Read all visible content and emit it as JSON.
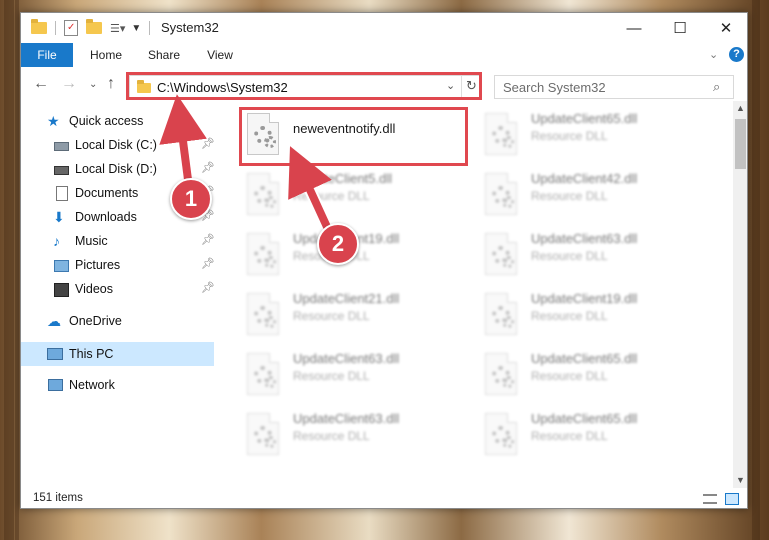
{
  "window": {
    "title": "System32",
    "controls": {
      "minimize": "—",
      "maximize": "☐",
      "close": "✕"
    }
  },
  "ribbon": {
    "tabs": [
      "File",
      "Home",
      "Share",
      "View"
    ],
    "help": "?"
  },
  "navigation": {
    "address": "C:\\Windows\\System32",
    "search_placeholder": "Search System32"
  },
  "sidebar": {
    "items": [
      {
        "label": "Quick access",
        "icon": "star-icon",
        "pinned": false
      },
      {
        "label": "Local Disk (C:)",
        "icon": "drive-icon",
        "pinned": true
      },
      {
        "label": "Local Disk (D:)",
        "icon": "drive-icon",
        "pinned": true
      },
      {
        "label": "Documents",
        "icon": "documents-icon",
        "pinned": true
      },
      {
        "label": "Downloads",
        "icon": "download-icon",
        "pinned": true
      },
      {
        "label": "Music",
        "icon": "music-icon",
        "pinned": true
      },
      {
        "label": "Pictures",
        "icon": "pictures-icon",
        "pinned": true
      },
      {
        "label": "Videos",
        "icon": "videos-icon",
        "pinned": true
      },
      {
        "label": "OneDrive",
        "icon": "cloud-icon",
        "pinned": false
      },
      {
        "label": "This PC",
        "icon": "computer-icon",
        "pinned": false,
        "selected": true
      },
      {
        "label": "Network",
        "icon": "network-icon",
        "pinned": false
      }
    ]
  },
  "files": {
    "column1": [
      {
        "name": "neweventnotify.dll",
        "type": ""
      },
      {
        "name": "UpdateClient5.dll",
        "type": "Resource DLL"
      },
      {
        "name": "UpdateClient19.dll",
        "type": "Resource DLL"
      },
      {
        "name": "UpdateClient21.dll",
        "type": "Resource DLL"
      },
      {
        "name": "UpdateClient63.dll",
        "type": "Resource DLL"
      },
      {
        "name": "UpdateClient63.dll",
        "type": "Resource DLL"
      }
    ],
    "column2": [
      {
        "name": "UpdateClient65.dll",
        "type": "Resource DLL"
      },
      {
        "name": "UpdateClient42.dll",
        "type": "Resource DLL"
      },
      {
        "name": "UpdateClient63.dll",
        "type": "Resource DLL"
      },
      {
        "name": "UpdateClient19.dll",
        "type": "Resource DLL"
      },
      {
        "name": "UpdateClient65.dll",
        "type": "Resource DLL"
      },
      {
        "name": "UpdateClient65.dll",
        "type": "Resource DLL"
      }
    ]
  },
  "status": {
    "item_count": "151 items"
  },
  "annotations": {
    "step1": "1",
    "step2": "2",
    "color": "#d9434d"
  }
}
